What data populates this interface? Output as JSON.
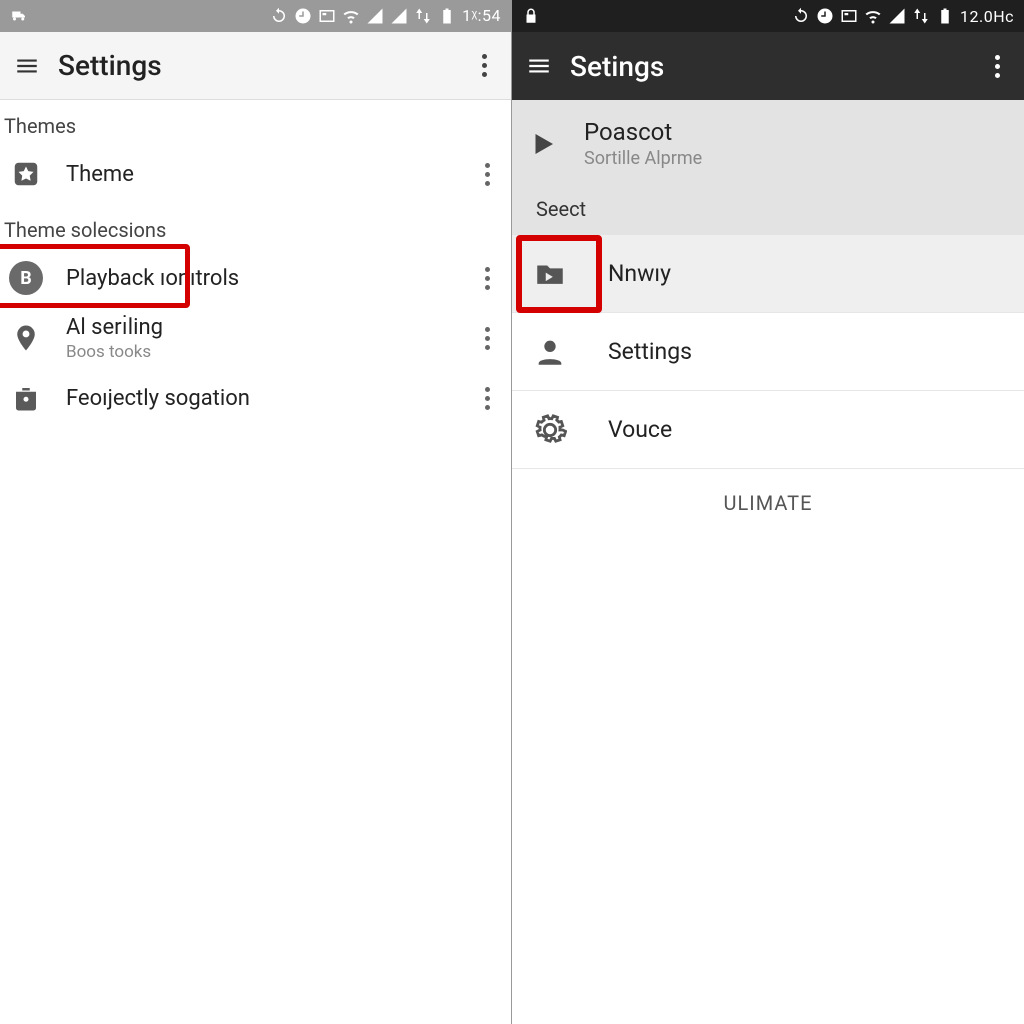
{
  "left": {
    "status_time": "1ᵡ:54",
    "appbar_title": "Settings",
    "section1": "Themes",
    "items1": [
      {
        "label": "Theme"
      }
    ],
    "section2": "Theme solecsions",
    "items2": [
      {
        "badge": "B",
        "label": "Playback ıonıtrols"
      },
      {
        "label": "Al serı̇ling",
        "sub": "Boos tooks"
      },
      {
        "label": "Feoıjectly sogation"
      }
    ]
  },
  "right": {
    "status_time": "12.0Hc",
    "appbar_title": "Setings",
    "now_playing": {
      "title": "Poascot",
      "subtitle": "Sortille Alprme"
    },
    "section": "Seect",
    "items": [
      {
        "label": "Nnwıy"
      },
      {
        "label": "Settings"
      },
      {
        "label": "Vouce"
      }
    ],
    "footer": "ULIMATE"
  },
  "colors": {
    "highlight": "#d40000"
  }
}
